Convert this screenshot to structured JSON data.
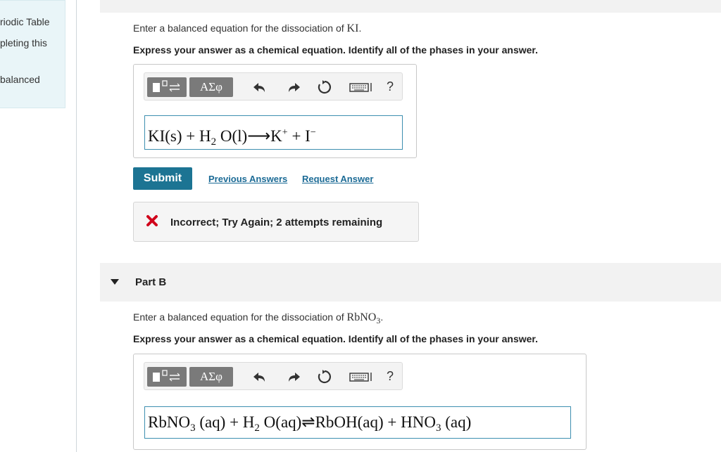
{
  "sidebar": {
    "lines": [
      "riodic Table",
      "pleting this",
      "balanced"
    ]
  },
  "partA": {
    "prompt_prefix": "Enter a balanced equation for the dissociation of ",
    "compound": "KI",
    "prompt_suffix": ".",
    "instruction": "Express your answer as a chemical equation. Identify all of the phases in your answer.",
    "toolbar": {
      "symbol_button": "ΑΣφ",
      "help": "?"
    },
    "answer": {
      "a1": "KI(s) + H",
      "a1_sub": "2",
      "a2": " O(l)⟶K",
      "a2_sup": "+",
      "a3": " + I",
      "a3_sup": "−"
    },
    "submit_label": "Submit",
    "previous_answers_label": "Previous Answers",
    "request_answer_label": "Request Answer",
    "feedback": "Incorrect; Try Again; 2 attempts remaining"
  },
  "partB": {
    "label": "Part B",
    "prompt_prefix": "Enter a balanced equation for the dissociation of ",
    "compound": "RbNO",
    "compound_sub": "3",
    "prompt_suffix": ".",
    "instruction": "Express your answer as a chemical equation. Identify all of the phases in your answer.",
    "toolbar": {
      "symbol_button": "ΑΣφ",
      "help": "?"
    },
    "answer": {
      "b1": "RbNO",
      "b1_sub": "3",
      "b2": " (aq) + H",
      "b2_sub": "2",
      "b3": " O(aq)⇌RbOH(aq) + HNO",
      "b3_sub": "3",
      "b4": " (aq)"
    }
  },
  "colors": {
    "accent": "#1c7493",
    "link": "#1c6b96",
    "error": "#d0021b",
    "answer_border": "#3d8fb0",
    "sidebar_bg": "#e9f5f8"
  }
}
